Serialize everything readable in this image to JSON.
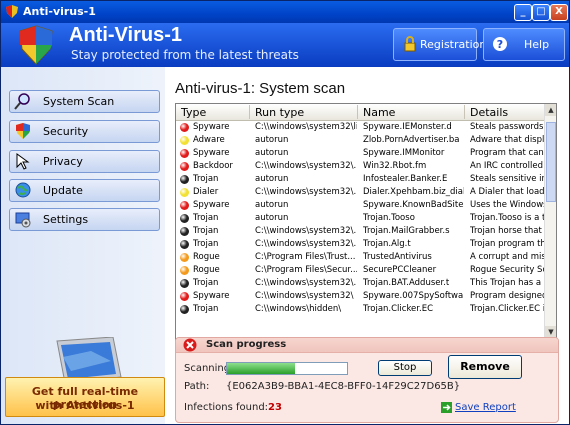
{
  "window": {
    "title": "Anti-virus-1",
    "controls": [
      "_",
      "□",
      "X"
    ]
  },
  "header": {
    "app_name": "Anti-Virus-1",
    "tagline": "Stay protected from the latest threats",
    "registration_label": "Registration",
    "help_label": "Help"
  },
  "sidebar": {
    "items": [
      {
        "label": "System Scan",
        "icon": "magnifier-icon"
      },
      {
        "label": "Security",
        "icon": "shield-icon"
      },
      {
        "label": "Privacy",
        "icon": "cursor-icon"
      },
      {
        "label": "Update",
        "icon": "globe-icon"
      },
      {
        "label": "Settings",
        "icon": "gear-icon"
      }
    ],
    "promo_line1": "Get full real-time protection",
    "promo_line2": "with Antivirus-1"
  },
  "main": {
    "title": "Anti-virus-1: System scan",
    "columns": [
      "Type",
      "Run type",
      "Name",
      "Details"
    ],
    "rows": [
      {
        "type": "Spyware",
        "run": "C:\\\\windows\\system32\\li...",
        "name": "Spyware.IEMonster.d",
        "details": "Steals passwords fro",
        "status": "red"
      },
      {
        "type": "Adware",
        "run": "autorun",
        "name": "Zlob.PornAdvertiser.ba",
        "details": "Adware that display",
        "status": "yellow"
      },
      {
        "type": "Spyware",
        "run": "autorun",
        "name": "Spyware.IMMonitor",
        "details": "Program that can be",
        "status": "red"
      },
      {
        "type": "Backdoor",
        "run": "C:\\\\windows\\system32\\...",
        "name": "Win32.Rbot.fm",
        "details": "An IRC controlled ba",
        "status": "red"
      },
      {
        "type": "Trojan",
        "run": "autorun",
        "name": "Infostealer.Banker.E",
        "details": "Steals sensitive info",
        "status": "black"
      },
      {
        "type": "Dialer",
        "run": "C:\\\\windows\\system32\\...",
        "name": "Dialer.Xpehbam.biz_dialer",
        "details": "A Dialer that loads p",
        "status": "yellow"
      },
      {
        "type": "Spyware",
        "run": "autorun",
        "name": "Spyware.KnownBadSites",
        "details": "Uses the Windows h",
        "status": "red"
      },
      {
        "type": "Trojan",
        "run": "autorun",
        "name": "Trojan.Tooso",
        "details": "Trojan.Tooso is a tro",
        "status": "black"
      },
      {
        "type": "Trojan",
        "run": "C:\\\\windows\\system32\\...",
        "name": "Trojan.MailGrabber.s",
        "details": "Trojan horse that ge",
        "status": "black"
      },
      {
        "type": "Trojan",
        "run": "C:\\\\windows\\system32\\...",
        "name": "Trojan.Alg.t",
        "details": "Trojan program that",
        "status": "black"
      },
      {
        "type": "Rogue",
        "run": "C:\\Program Files\\Trust...",
        "name": "TrustedAntivirus",
        "details": "A corrupt and misleа",
        "status": "orange"
      },
      {
        "type": "Rogue",
        "run": "C:\\Program Files\\Secur...",
        "name": "SecurePCCleaner",
        "details": "Rogue Security Softv",
        "status": "orange"
      },
      {
        "type": "Trojan",
        "run": "C:\\\\windows\\system32\\...",
        "name": "Trojan.BAT.Adduser.t",
        "details": "This Trojan has a ma",
        "status": "black"
      },
      {
        "type": "Spyware",
        "run": "C:\\\\windows\\system32\\",
        "name": "Spyware.007SpySoftware",
        "details": "Program designed to",
        "status": "red"
      },
      {
        "type": "Trojan",
        "run": "C:\\\\windows\\hidden\\",
        "name": "Trojan.Clicker.EC",
        "details": "Trojan.Clicker.EC is",
        "status": "black"
      }
    ]
  },
  "scan": {
    "title": "Scan progress",
    "scanning_label": "Scanning:",
    "progress": 0.57,
    "stop_label": "Stop",
    "remove_label": "Remove",
    "path_label": "Path:",
    "path_value": "{E062A3B9-BBA1-4EC8-BFF0-14F29C27D65B}",
    "infections_label": "Infections found:",
    "infections_count": "23",
    "save_report_label": "Save Report"
  },
  "colors": {
    "red": "#e11b1b",
    "yellow": "#f2e033",
    "black": "#222222",
    "orange": "#f39a1c"
  }
}
